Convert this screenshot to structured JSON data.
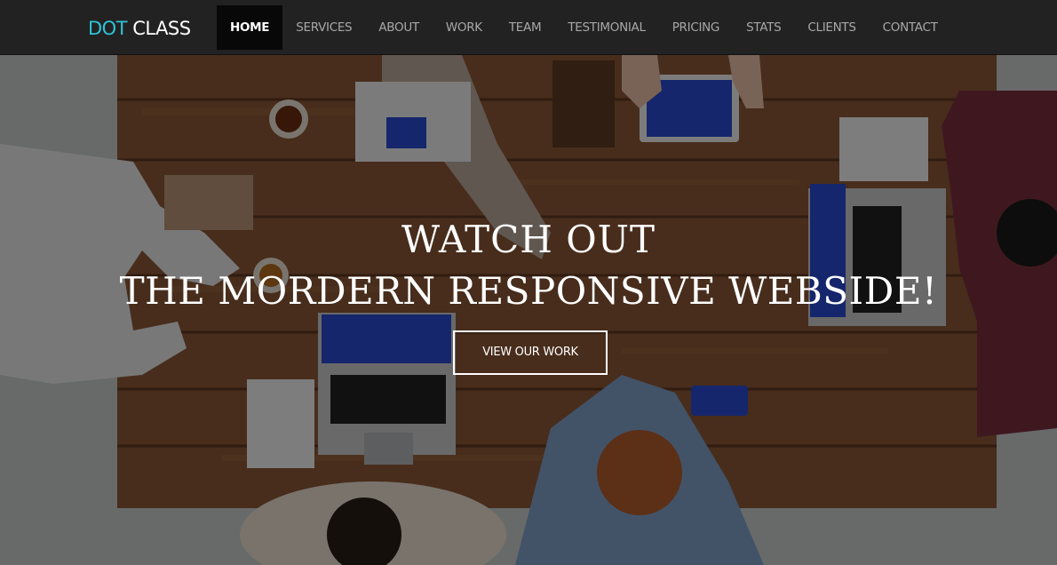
{
  "brand": {
    "part1": "DOT",
    "part2": "CLASS",
    "accent_color": "#2ec4d6"
  },
  "nav": {
    "items": [
      {
        "label": "HOME",
        "active": true
      },
      {
        "label": "SERVICES",
        "active": false
      },
      {
        "label": "ABOUT",
        "active": false
      },
      {
        "label": "WORK",
        "active": false
      },
      {
        "label": "TEAM",
        "active": false
      },
      {
        "label": "TESTIMONIAL",
        "active": false
      },
      {
        "label": "PRICING",
        "active": false
      },
      {
        "label": "STATS",
        "active": false
      },
      {
        "label": "CLIENTS",
        "active": false
      },
      {
        "label": "CONTACT",
        "active": false
      }
    ]
  },
  "hero": {
    "title_line1": "WATCH OUT",
    "title_line2": "THE MORDERN RESPONSIVE WEBSIDE!",
    "cta_label": "VIEW OUR WORK"
  },
  "colors": {
    "navbar_bg": "#222222",
    "active_nav_bg": "#080808",
    "nav_text": "#a8a8a8",
    "hero_text": "#ffffff"
  }
}
